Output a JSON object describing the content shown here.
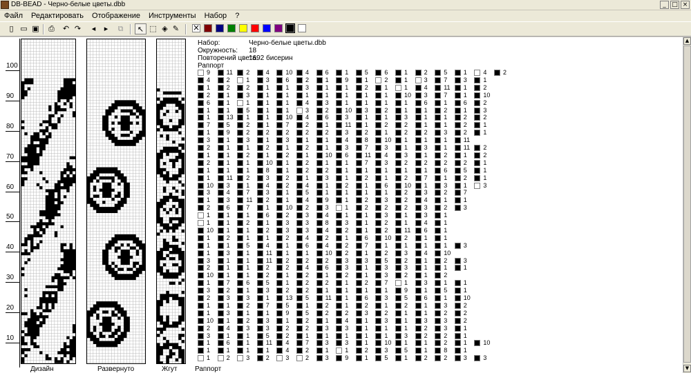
{
  "window": {
    "title": "DB-BEAD - Черно-белые цветы.dbb",
    "minimize": "_",
    "maximize": "□",
    "close": "×"
  },
  "menu": [
    "Файл",
    "Редактировать",
    "Отображение",
    "Инструменты",
    "Набор",
    "?"
  ],
  "toolbar": {
    "icons": [
      "new-icon",
      "open-icon",
      "save-icon",
      "print-icon",
      "undo-icon",
      "redo-icon",
      "arrow-left-icon",
      "arrow-right-icon",
      "copy-icon",
      "pointer-icon",
      "select-rect-icon",
      "fill-icon",
      "eyedropper-icon"
    ],
    "colors": [
      "#800000",
      "#000080",
      "#008000",
      "#ffff00",
      "#ff0000",
      "#0000ff",
      "#800080",
      "#000000",
      "#ffffff"
    ],
    "selected_tool": "pointer-icon",
    "clear_swatch": "×"
  },
  "ruler": {
    "labels": [
      "100",
      "90",
      "80",
      "70",
      "60",
      "50",
      "40",
      "30",
      "20",
      "10"
    ]
  },
  "grids": {
    "design_label": "Дизайн",
    "unrolled_label": "Развернуто",
    "tube_label": "Жгут",
    "rapport_label": "Раппорт"
  },
  "info": {
    "set_label": "Набор:",
    "set_value": "Черно-белые цветы.dbb",
    "circ_label": "Окружность:",
    "circ_value": "18",
    "repeat_label": "Повторений цвета:",
    "repeat_value": "1692 бисерин",
    "rapport_label": "Раппорт"
  },
  "rapport_rows": [
    [
      "w9",
      "b11",
      "b2",
      "b4",
      "b10",
      "b4",
      "b6",
      "b1",
      "b5",
      "b6",
      "b1",
      "b2",
      "b5",
      "b1",
      "w4",
      "b2"
    ],
    [
      "b4",
      "b2",
      "w1",
      "b3",
      "b6",
      "b2",
      "b1",
      "b9",
      "b1",
      "w2",
      "b1",
      "w3",
      "b7",
      "b3",
      "b1"
    ],
    [
      "b1",
      "b2",
      "b2",
      "b1",
      "b1",
      "b3",
      "b1",
      "b1",
      "b2",
      "b1",
      "w1",
      "b4",
      "b11",
      "b1",
      "b2"
    ],
    [
      "b2",
      "b1",
      "b3",
      "b1",
      "b1",
      "b1",
      "b1",
      "b1",
      "b1",
      "b1",
      "b10",
      "b3",
      "b7",
      "b1",
      "b10"
    ],
    [
      "b6",
      "b1",
      "w1",
      "b1",
      "b1",
      "b4",
      "b3",
      "b1",
      "b1",
      "b1",
      "b1",
      "b6",
      "b1",
      "b6",
      "b2"
    ],
    [
      "b1",
      "b1",
      "b5",
      "b1",
      "b1",
      "w3",
      "b2",
      "b10",
      "b3",
      "b2",
      "b1",
      "b1",
      "b2",
      "b1",
      "b3"
    ],
    [
      "b1",
      "b13",
      "b1",
      "b1",
      "b10",
      "b4",
      "b6",
      "b3",
      "b1",
      "b1",
      "b3",
      "b1",
      "b1",
      "b2",
      "b2"
    ],
    [
      "b7",
      "b5",
      "b2",
      "b1",
      "b7",
      "b2",
      "b1",
      "b11",
      "b1",
      "b2",
      "b2",
      "b1",
      "b1",
      "b2",
      "b1"
    ],
    [
      "b1",
      "b9",
      "b2",
      "b2",
      "b2",
      "b2",
      "b2",
      "b3",
      "b2",
      "b1",
      "b2",
      "b2",
      "b3",
      "b2",
      "b1"
    ],
    [
      "b3",
      "b1",
      "b3",
      "b1",
      "b3",
      "b1",
      "b1",
      "b4",
      "b8",
      "b10",
      "b1",
      "b1",
      "b1",
      "b11"
    ],
    [
      "b2",
      "b1",
      "b1",
      "b2",
      "b1",
      "b2",
      "b1",
      "b3",
      "b7",
      "b3",
      "b1",
      "b3",
      "b1",
      "b11",
      "b2"
    ],
    [
      "b1",
      "b1",
      "b2",
      "b1",
      "b2",
      "b1",
      "b10",
      "b6",
      "b11",
      "b4",
      "b3",
      "b1",
      "b2",
      "b1",
      "b2"
    ],
    [
      "b2",
      "b1",
      "b1",
      "b10",
      "b1",
      "b2",
      "b1",
      "b1",
      "b7",
      "b3",
      "b2",
      "b2",
      "b2",
      "b2",
      "b1"
    ],
    [
      "b1",
      "b1",
      "b1",
      "b8",
      "b1",
      "b2",
      "b2",
      "b1",
      "b1",
      "b1",
      "b1",
      "b1",
      "b6",
      "b5",
      "b1"
    ],
    [
      "b1",
      "b11",
      "b2",
      "b3",
      "b2",
      "b1",
      "b3",
      "b1",
      "b2",
      "b1",
      "b2",
      "b7",
      "b1",
      "b2",
      "b1"
    ],
    [
      "b10",
      "b3",
      "b1",
      "b4",
      "b2",
      "b4",
      "b1",
      "b2",
      "b1",
      "b6",
      "b10",
      "b1",
      "b3",
      "b1",
      "w3"
    ],
    [
      "b3",
      "b4",
      "b7",
      "b3",
      "b1",
      "b5",
      "b1",
      "b1",
      "b1",
      "b1",
      "b2",
      "b3",
      "b2",
      "b7"
    ],
    [
      "b1",
      "b3",
      "b11",
      "b2",
      "b1",
      "b4",
      "b9",
      "b1",
      "b2",
      "b3",
      "b2",
      "b4",
      "b1",
      "b1"
    ],
    [
      "b2",
      "b6",
      "b7",
      "b1",
      "b10",
      "b2",
      "b3",
      "w1",
      "b2",
      "b2",
      "b2",
      "b3",
      "b2",
      "b3"
    ],
    [
      "w1",
      "b1",
      "b1",
      "b6",
      "b2",
      "b3",
      "b4",
      "b1",
      "b1",
      "b3",
      "b1",
      "b3",
      "b1"
    ],
    [
      "w1",
      "b1",
      "b2",
      "b1",
      "b3",
      "b3",
      "b8",
      "b3",
      "b1",
      "b2",
      "b1",
      "b4",
      "b1"
    ],
    [
      "b10",
      "b1",
      "b1",
      "b2",
      "b3",
      "b3",
      "b4",
      "b2",
      "b1",
      "b2",
      "b11",
      "b6",
      "b1"
    ],
    [
      "b1",
      "b2",
      "b1",
      "b1",
      "b2",
      "b4",
      "b2",
      "b1",
      "b6",
      "b10",
      "b2",
      "b1",
      "b1"
    ],
    [
      "b1",
      "b1",
      "b5",
      "b4",
      "b1",
      "b6",
      "b4",
      "b2",
      "b7",
      "b1",
      "b1",
      "b1",
      "b1",
      "b3"
    ],
    [
      "b1",
      "b3",
      "b1",
      "b11",
      "b1",
      "b1",
      "b10",
      "b2",
      "b1",
      "b2",
      "b3",
      "b4",
      "b10"
    ],
    [
      "b3",
      "b1",
      "b1",
      "b11",
      "b2",
      "b2",
      "b2",
      "b3",
      "b3",
      "b5",
      "b2",
      "b1",
      "b2",
      "b3"
    ],
    [
      "b2",
      "b1",
      "b1",
      "b2",
      "b2",
      "b4",
      "b6",
      "b3",
      "b1",
      "b3",
      "b3",
      "b1",
      "b1",
      "b1"
    ],
    [
      "b10",
      "b1",
      "b1",
      "b2",
      "b1",
      "b2",
      "b1",
      "b2",
      "b1",
      "b3",
      "b2",
      "b1",
      "b2"
    ],
    [
      "b1",
      "b7",
      "b6",
      "b5",
      "b1",
      "b2",
      "b2",
      "b1",
      "b2",
      "b7",
      "w1",
      "b3",
      "b1",
      "b1"
    ],
    [
      "b3",
      "b2",
      "b1",
      "b3",
      "b2",
      "b2",
      "b1",
      "b1",
      "b1",
      "b1",
      "b9",
      "b1",
      "b5",
      "b1"
    ],
    [
      "b2",
      "b3",
      "b3",
      "b1",
      "b13",
      "b5",
      "b11",
      "b1",
      "b6",
      "b3",
      "b5",
      "b6",
      "b1",
      "b10"
    ],
    [
      "b1",
      "b1",
      "b2",
      "b7",
      "b5",
      "b1",
      "b2",
      "b1",
      "b2",
      "b1",
      "b2",
      "b1",
      "b3",
      "b2"
    ],
    [
      "b1",
      "b3",
      "b1",
      "b1",
      "b9",
      "b5",
      "b2",
      "b2",
      "b3",
      "b2",
      "b1",
      "b1",
      "b2",
      "b2"
    ],
    [
      "b10",
      "b1",
      "b2",
      "b3",
      "b1",
      "b2",
      "b1",
      "b4",
      "b1",
      "b3",
      "b1",
      "b3",
      "b3",
      "b2"
    ],
    [
      "b2",
      "b4",
      "b3",
      "b3",
      "b2",
      "b2",
      "b3",
      "b3",
      "b1",
      "b1",
      "b1",
      "b2",
      "b3",
      "b1"
    ],
    [
      "b3",
      "b1",
      "b1",
      "b5",
      "b2",
      "b1",
      "b1",
      "b1",
      "b1",
      "b1",
      "b3",
      "b2",
      "b2",
      "b1"
    ],
    [
      "b1",
      "b6",
      "b1",
      "b11",
      "b4",
      "b7",
      "b3",
      "b3",
      "b1",
      "b10",
      "b1",
      "b1",
      "b2",
      "b1",
      "b10"
    ],
    [
      "b1",
      "b1",
      "b1",
      "b1",
      "b4",
      "b2",
      "b1",
      "w1",
      "b2",
      "b3",
      "b5",
      "b1",
      "b8",
      "b1"
    ],
    [
      "w1",
      "w2",
      "w3",
      "b2",
      "w3",
      "w2",
      "b3",
      "b9",
      "b1",
      "b5",
      "b1",
      "b2",
      "b2",
      "b3",
      "b3"
    ]
  ]
}
